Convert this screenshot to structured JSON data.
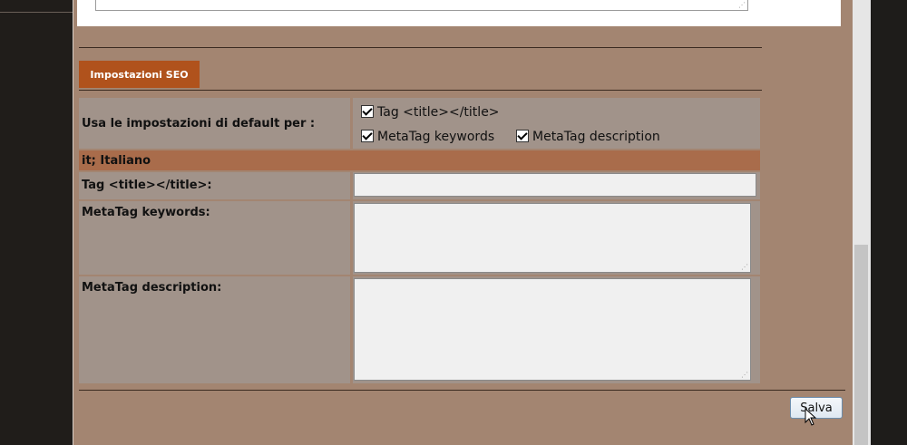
{
  "seo_tab": "Impostazioni SEO",
  "defaults": {
    "label": "Usa le impostazioni di default per :",
    "options": [
      {
        "label": "Tag <title></title>",
        "checked": true
      },
      {
        "label": "MetaTag keywords",
        "checked": true
      },
      {
        "label": "MetaTag description",
        "checked": true
      }
    ]
  },
  "language_header": "it; Italiano",
  "fields": {
    "title_label": "Tag <title></title>:",
    "title_value": "",
    "keywords_label": "MetaTag keywords:",
    "keywords_value": "",
    "description_label": "MetaTag description:",
    "description_value": ""
  },
  "save_label": "Salva",
  "colors": {
    "panel_bg": "#a38571",
    "tab_bg": "#b0521c",
    "language_row_bg": "#a96c4b",
    "cell_bg": "#a1938a"
  }
}
